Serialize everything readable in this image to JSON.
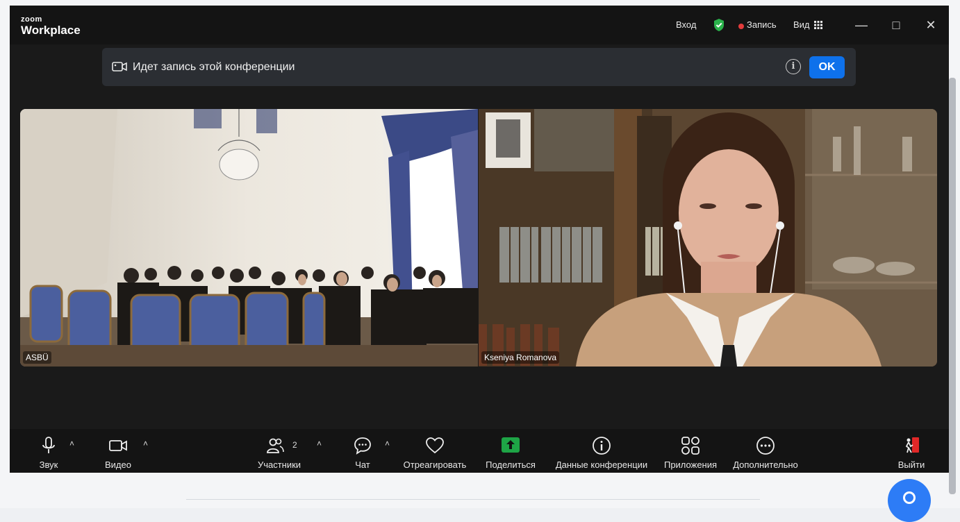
{
  "window": {
    "logo_small": "zoom",
    "logo_large": "Workplace",
    "signin_label": "Вход",
    "recording_label": "Запись",
    "view_label": "Вид",
    "minimize_glyph": "—",
    "maximize_glyph": "□",
    "close_glyph": "✕"
  },
  "banner": {
    "text": "Идет запись этой конференции",
    "info_glyph": "i",
    "ok_label": "OK"
  },
  "participants_tiles": [
    {
      "name": "ASBÜ"
    },
    {
      "name": "Kseniya Romanova"
    }
  ],
  "toolbar": {
    "audio_label": "Звук",
    "video_label": "Видео",
    "participants_label": "Участники",
    "participants_count": "2",
    "chat_label": "Чат",
    "react_label": "Отреагировать",
    "share_label": "Поделиться",
    "info_label": "Данные конференции",
    "apps_label": "Приложения",
    "more_label": "Дополнительно",
    "leave_label": "Выйти",
    "caret_glyph": "˄"
  },
  "colors": {
    "accent": "#0e71eb",
    "share_green": "#1ea446",
    "recording_red": "#e23b3b",
    "shield_green": "#2bb24c",
    "leave_red": "#e02828"
  }
}
